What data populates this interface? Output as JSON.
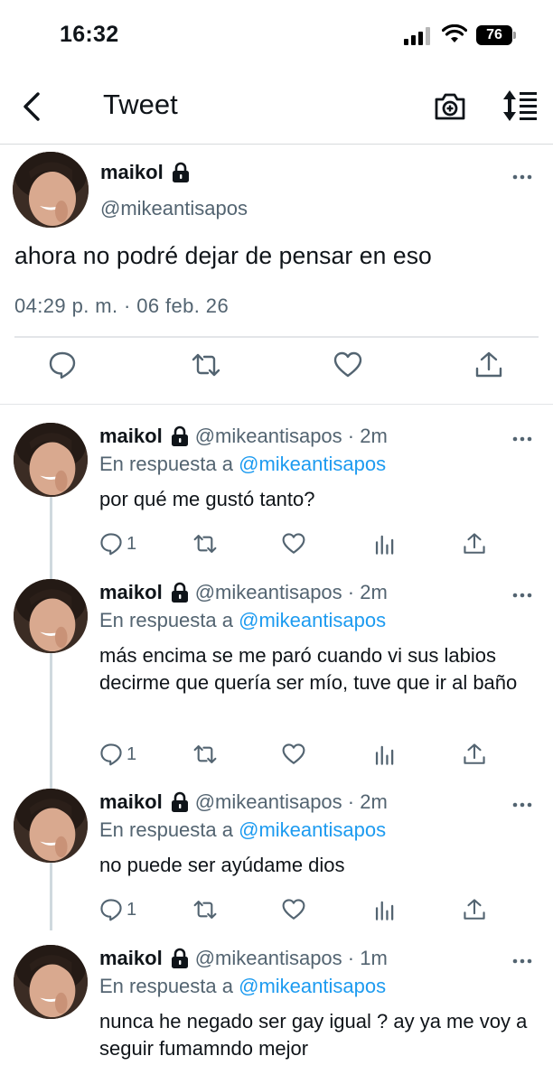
{
  "status_bar": {
    "time": "16:32",
    "battery": "76"
  },
  "nav": {
    "title": "Tweet",
    "icons": [
      "back-chevron-icon",
      "camera-icon",
      "sort-icon"
    ]
  },
  "main_tweet": {
    "name": "maikol",
    "handle": "@mikeantisapos",
    "text": "ahora no podré dejar de pensar en eso",
    "timestamp": "04:29 p. m. · 06 feb. 26"
  },
  "replies": [
    {
      "name": "maikol",
      "handle": "@mikeantisapos · 2m",
      "in_reply_prefix": "En respuesta a",
      "in_reply_to": "@mikeantisapos",
      "text": "por qué me gustó tanto?",
      "reply_count": "1"
    },
    {
      "name": "maikol",
      "handle": "@mikeantisapos · 2m",
      "in_reply_prefix": "En respuesta a",
      "in_reply_to": "@mikeantisapos",
      "text": "más encima se me paró cuando vi sus labios decirme que quería ser mío, tuve que ir al baño",
      "reply_count": "1"
    },
    {
      "name": "maikol",
      "handle": "@mikeantisapos · 2m",
      "in_reply_prefix": "En respuesta a",
      "in_reply_to": "@mikeantisapos",
      "text": "no puede ser ayúdame dios",
      "reply_count": "1"
    },
    {
      "name": "maikol",
      "handle": "@mikeantisapos · 1m",
      "in_reply_prefix": "En respuesta a",
      "in_reply_to": "@mikeantisapos",
      "text": "nunca he negado ser gay igual ? ay ya me voy a seguir fumamndo mejor",
      "reply_count": ""
    }
  ],
  "colors": {
    "link": "#1d9bf0",
    "secondary_text": "#536471",
    "primary_text": "#0f1419",
    "divider": "#e3e5e8"
  }
}
